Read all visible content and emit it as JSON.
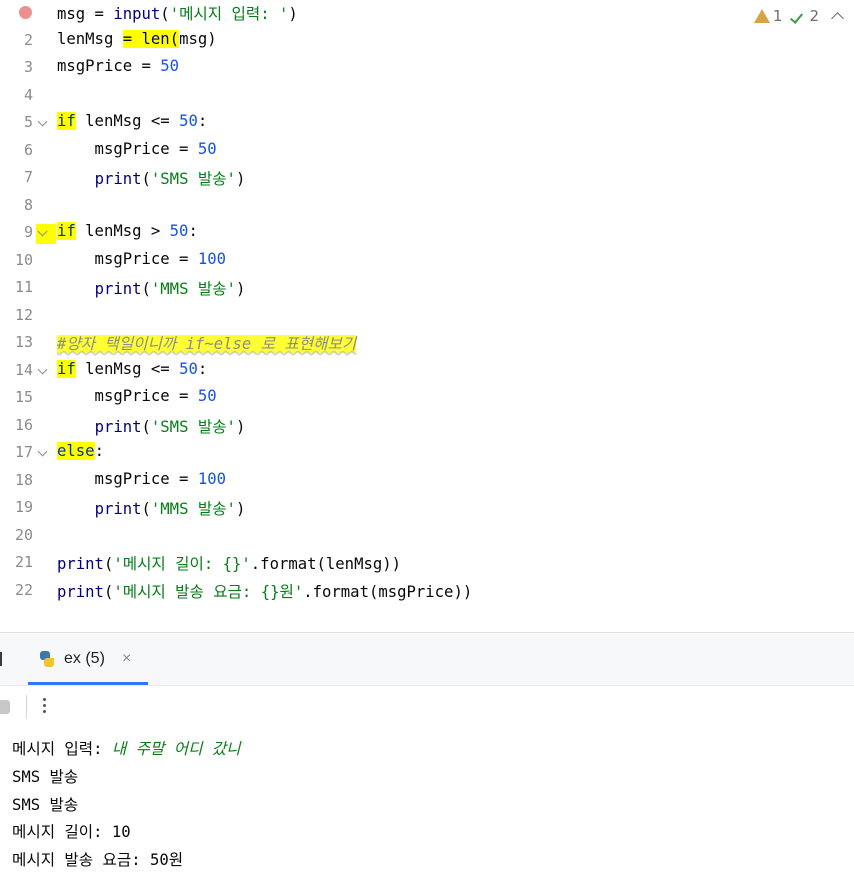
{
  "inspections": {
    "warnings": "1",
    "checks": "2"
  },
  "code_lines": [
    {
      "n": "1",
      "t": "msg = input('메시지 입력: ')"
    },
    {
      "n": "2",
      "t": "lenMsg = len(msg)"
    },
    {
      "n": "3",
      "t": "msgPrice = 50"
    },
    {
      "n": "4",
      "t": ""
    },
    {
      "n": "5",
      "t": "if lenMsg <= 50:"
    },
    {
      "n": "6",
      "t": "    msgPrice = 50"
    },
    {
      "n": "7",
      "t": "    print('SMS 발송')"
    },
    {
      "n": "8",
      "t": ""
    },
    {
      "n": "9",
      "t": "if lenMsg > 50:"
    },
    {
      "n": "10",
      "t": "    msgPrice = 100"
    },
    {
      "n": "11",
      "t": "    print('MMS 발송')"
    },
    {
      "n": "12",
      "t": ""
    },
    {
      "n": "13",
      "t": "#양자 택일이니까 if~else 로 표현해보기"
    },
    {
      "n": "14",
      "t": "if lenMsg <= 50:"
    },
    {
      "n": "15",
      "t": "    msgPrice = 50"
    },
    {
      "n": "16",
      "t": "    print('SMS 발송')"
    },
    {
      "n": "17",
      "t": "else:"
    },
    {
      "n": "18",
      "t": "    msgPrice = 100"
    },
    {
      "n": "19",
      "t": "    print('MMS 발송')"
    },
    {
      "n": "20",
      "t": ""
    },
    {
      "n": "21",
      "t": "print('메시지 길이: {}'.format(lenMsg))"
    },
    {
      "n": "22",
      "t": "print('메시지 발송 요금: {}원'.format(msgPrice))"
    }
  ],
  "run_tab": {
    "label": "ex (5)",
    "close": "×"
  },
  "console": {
    "prompt": "메시지 입력: ",
    "user_input": "내 주말 어디 갔니",
    "lines": [
      "SMS 발송",
      "SMS 발송",
      "메시지 길이: 10",
      "메시지 발송 요금: 50원"
    ]
  },
  "colors": {
    "keyword": "#0033b3",
    "string": "#067d17",
    "number": "#1750eb",
    "comment": "#8c8c8c",
    "highlight": "#ffff00",
    "tab_accent": "#3574f0"
  }
}
